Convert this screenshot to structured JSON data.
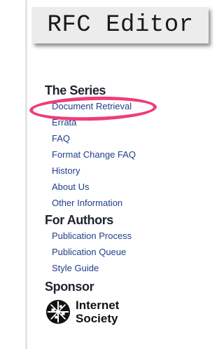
{
  "site": {
    "logo_text": "RFC Editor"
  },
  "sections": [
    {
      "title": "The Series",
      "links": [
        "Document Retrieval",
        "Errata",
        "FAQ",
        "Format Change FAQ",
        "History",
        "About Us",
        "Other Information"
      ]
    },
    {
      "title": "For Authors",
      "links": [
        "Publication Process",
        "Publication Queue",
        "Style Guide"
      ]
    },
    {
      "title": "Sponsor",
      "sponsor_logo_text": [
        "Internet",
        "Society"
      ],
      "sponsor_icon": "internet-society-globe-icon"
    }
  ],
  "colors": {
    "link": "#1f3f86",
    "highlight_ring": "#ee3d7a",
    "logo_bg": "#ececec"
  }
}
